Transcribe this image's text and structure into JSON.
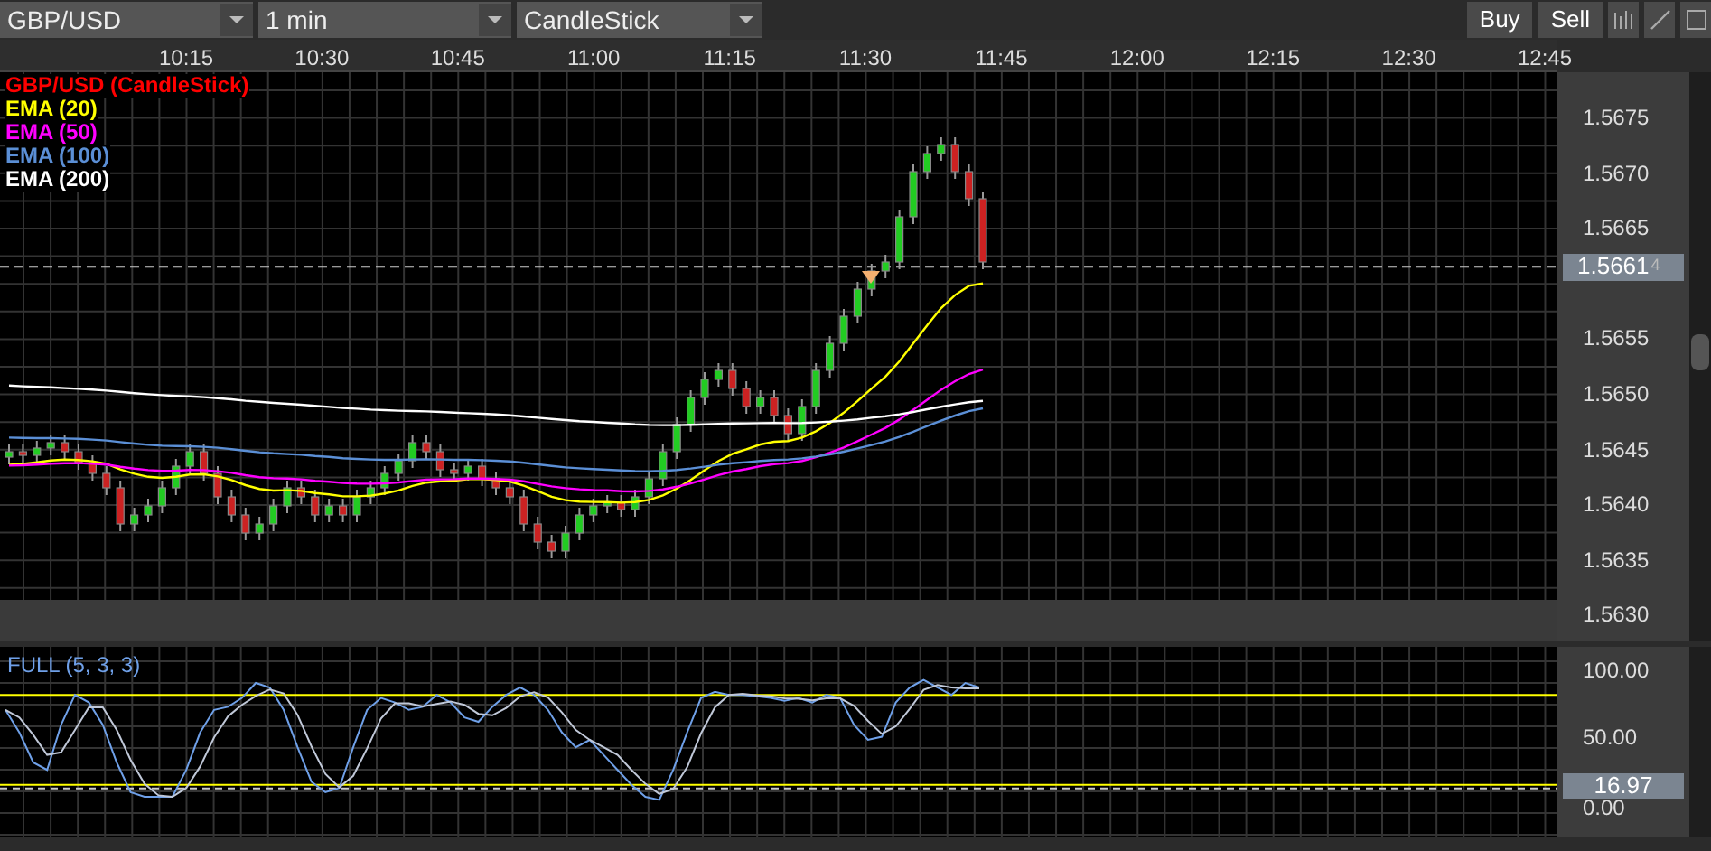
{
  "toolbar": {
    "dropdowns": [
      {
        "kind": "symbol",
        "value": "GBP/USD"
      },
      {
        "kind": "interval",
        "value": "1 min"
      },
      {
        "kind": "chart_type",
        "value": "CandleStick"
      }
    ],
    "buttons": [
      "Buy",
      "Sell"
    ]
  },
  "time_axis": [
    "10:15",
    "10:30",
    "10:45",
    "11:00",
    "11:15",
    "11:30",
    "11:45",
    "12:00",
    "12:15",
    "12:30",
    "12:45"
  ],
  "price_chart": {
    "legend": [
      {
        "label": "GBP/USD (CandleStick)",
        "color": "#ff0000"
      },
      {
        "label": "EMA (20)",
        "color": "#ffff00"
      },
      {
        "label": "EMA (50)",
        "color": "#ff00ff"
      },
      {
        "label": "EMA (100)",
        "color": "#5b8fd6"
      },
      {
        "label": "EMA (200)",
        "color": "#ffffff"
      }
    ],
    "price_axis": [
      "1.5675",
      "1.5670",
      "1.5665",
      "1.5655",
      "1.5650",
      "1.5645",
      "1.5640",
      "1.5635",
      "1.5630"
    ],
    "current_price": "1.5661",
    "current_price_pipette": "4"
  },
  "oscillator": {
    "title": "FULL (5, 3, 3)",
    "axis": [
      "100.00",
      "50.00",
      "0.00"
    ],
    "current_value": "16.97"
  }
}
